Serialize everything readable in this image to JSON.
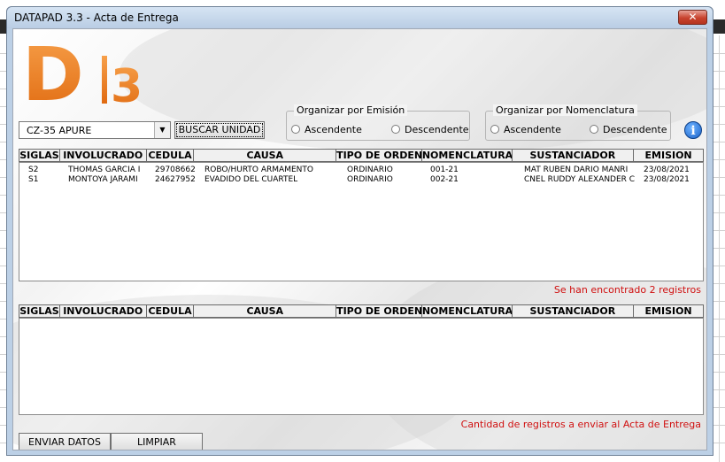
{
  "window": {
    "title": "DATAPAD 3.3 - Acta de Entrega",
    "close_label": "✕"
  },
  "logo": {
    "letter": "D",
    "number": "3"
  },
  "unit_select": {
    "value": "CZ-35 APURE",
    "arrow": "▼"
  },
  "buscar_button": "BUSCAR UNIDAD",
  "sort_emision": {
    "title": "Organizar por Emisión",
    "asc": "Ascendente",
    "desc": "Descendente"
  },
  "sort_nomenclatura": {
    "title": "Organizar por Nomenclatura",
    "asc": "Ascendente",
    "desc": "Descendente"
  },
  "info_icon": "i",
  "columns": [
    "SIGLAS",
    "INVOLUCRADO",
    "CEDULA",
    "CAUSA",
    "TIPO DE ORDEN",
    "NOMENCLATURA",
    "SUSTANCIADOR",
    "EMISION"
  ],
  "results": [
    {
      "siglas": "S2",
      "involucrado": "THOMAS GARCIA I",
      "cedula": "29708662",
      "causa": "ROBO/HURTO ARMAMENTO",
      "tipo": "ORDINARIO",
      "nomenclatura": "001-21",
      "sustanciador": "MAT RUBEN DARIO MANRI",
      "emision": "23/08/2021"
    },
    {
      "siglas": "S1",
      "involucrado": "MONTOYA JARAMI",
      "cedula": "24627952",
      "causa": "EVADIDO DEL CUARTEL",
      "tipo": "ORDINARIO",
      "nomenclatura": "002-21",
      "sustanciador": "CNEL RUDDY ALEXANDER C",
      "emision": "23/08/2021"
    }
  ],
  "found_status": "Se han encontrado 2 registros",
  "send_status": "Cantidad de registros a enviar al Acta de Entrega",
  "buttons": {
    "enviar": "ENVIAR DATOS",
    "limpiar": "LIMPIAR"
  }
}
